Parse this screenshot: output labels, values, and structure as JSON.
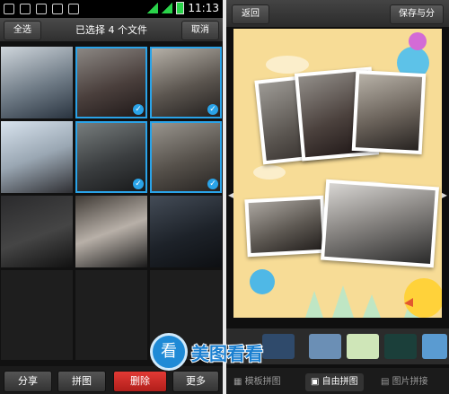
{
  "left": {
    "status": {
      "time": "11:13"
    },
    "header": {
      "select_all": "全选",
      "title": "已选择 4 个文件",
      "cancel": "取消"
    },
    "actions": {
      "share": "分享",
      "collage": "拼图",
      "delete": "删除",
      "more": "更多"
    }
  },
  "right": {
    "header": {
      "back": "返回",
      "save": "保存与分"
    },
    "tabs": {
      "template": "模板拼图",
      "free": "自由拼图",
      "stitch": "图片拼接"
    }
  },
  "watermark": {
    "text": "美图看看",
    "logo_char": "看"
  },
  "colors": {
    "accent": "#2aa3e8",
    "delete": "#d42a25",
    "canvas": "#f7dc96"
  }
}
